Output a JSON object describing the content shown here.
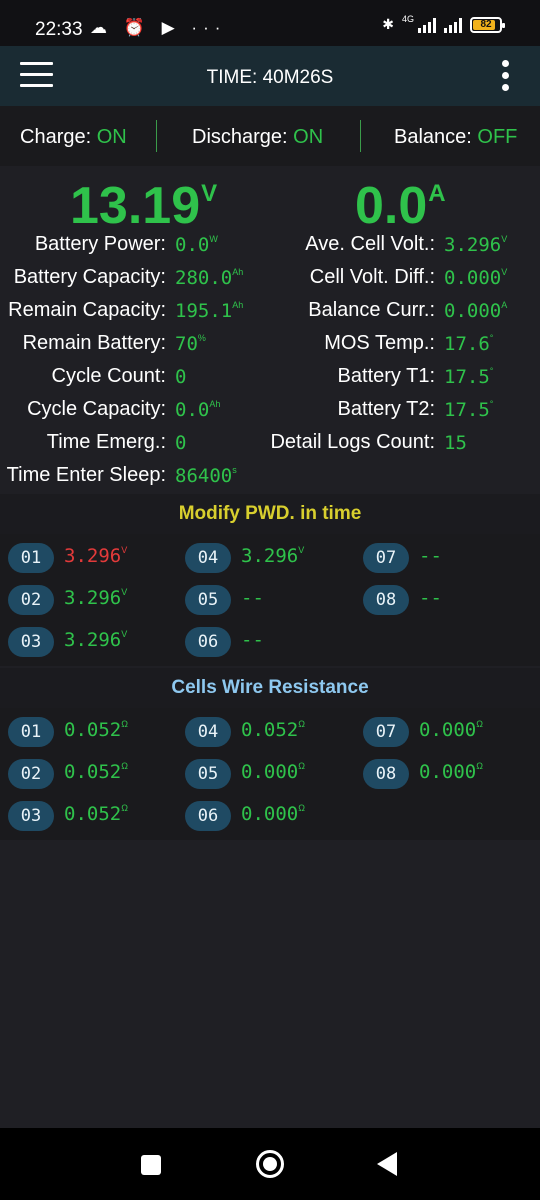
{
  "status_bar": {
    "time": "22:33",
    "left_icons": "☁ ⏰ ▶ ···",
    "net_label": "4G",
    "battery": "82"
  },
  "app_bar": {
    "title": "TIME: 40M26S"
  },
  "switches": [
    {
      "label": "Charge:",
      "value": "ON"
    },
    {
      "label": "Discharge:",
      "value": "ON"
    },
    {
      "label": "Balance:",
      "value": "OFF"
    }
  ],
  "voltage": {
    "value": "13.19",
    "unit": "V"
  },
  "current": {
    "value": "0.0",
    "unit": "A"
  },
  "left_stats": [
    {
      "label": "Battery Power:",
      "value": "0.0",
      "unit": "W"
    },
    {
      "label": "Battery Capacity:",
      "value": "280.0",
      "unit": "Ah"
    },
    {
      "label": "Remain Capacity:",
      "value": "195.1",
      "unit": "Ah"
    },
    {
      "label": "Remain Battery:",
      "value": "70",
      "unit": "%"
    },
    {
      "label": "Cycle Count:",
      "value": "0",
      "unit": ""
    },
    {
      "label": "Cycle Capacity:",
      "value": "0.0",
      "unit": "Ah"
    },
    {
      "label": "Time Emerg.:",
      "value": "0",
      "unit": ""
    },
    {
      "label": "Time Enter Sleep:",
      "value": "86400",
      "unit": "s"
    }
  ],
  "right_stats": [
    {
      "label": "Ave. Cell Volt.:",
      "value": "3.296",
      "unit": "V"
    },
    {
      "label": "Cell Volt. Diff.:",
      "value": "0.000",
      "unit": "V"
    },
    {
      "label": "Balance Curr.:",
      "value": "0.000",
      "unit": "A"
    },
    {
      "label": "MOS Temp.:",
      "value": "17.6",
      "unit": "°"
    },
    {
      "label": "Battery T1:",
      "value": "17.5",
      "unit": "°"
    },
    {
      "label": "Battery T2:",
      "value": "17.5",
      "unit": "°"
    },
    {
      "label": "Detail Logs Count:",
      "value": "15",
      "unit": ""
    }
  ],
  "pwd_section": {
    "title": "Modify PWD. in time",
    "color": "#d8cf2e"
  },
  "cell_voltages": [
    {
      "id": "01",
      "value": "3.296",
      "unit": "V",
      "highlight": true
    },
    {
      "id": "02",
      "value": "3.296",
      "unit": "V"
    },
    {
      "id": "03",
      "value": "3.296",
      "unit": "V"
    },
    {
      "id": "04",
      "value": "3.296",
      "unit": "V"
    },
    {
      "id": "05",
      "value": "--",
      "unit": ""
    },
    {
      "id": "06",
      "value": "--",
      "unit": ""
    },
    {
      "id": "07",
      "value": "--",
      "unit": ""
    },
    {
      "id": "08",
      "value": "--",
      "unit": ""
    }
  ],
  "resistance_section": {
    "title": "Cells Wire Resistance",
    "color": "#8ec8ef"
  },
  "cell_resistances": [
    {
      "id": "01",
      "value": "0.052",
      "unit": "Ω"
    },
    {
      "id": "02",
      "value": "0.052",
      "unit": "Ω"
    },
    {
      "id": "03",
      "value": "0.052",
      "unit": "Ω"
    },
    {
      "id": "04",
      "value": "0.052",
      "unit": "Ω"
    },
    {
      "id": "05",
      "value": "0.000",
      "unit": "Ω"
    },
    {
      "id": "06",
      "value": "0.000",
      "unit": "Ω"
    },
    {
      "id": "07",
      "value": "0.000",
      "unit": "Ω"
    },
    {
      "id": "08",
      "value": "0.000",
      "unit": "Ω"
    }
  ],
  "colors": {
    "accent_green": "#2fc24b",
    "alert_red": "#e23a3a",
    "badge": "#1f4a63"
  }
}
